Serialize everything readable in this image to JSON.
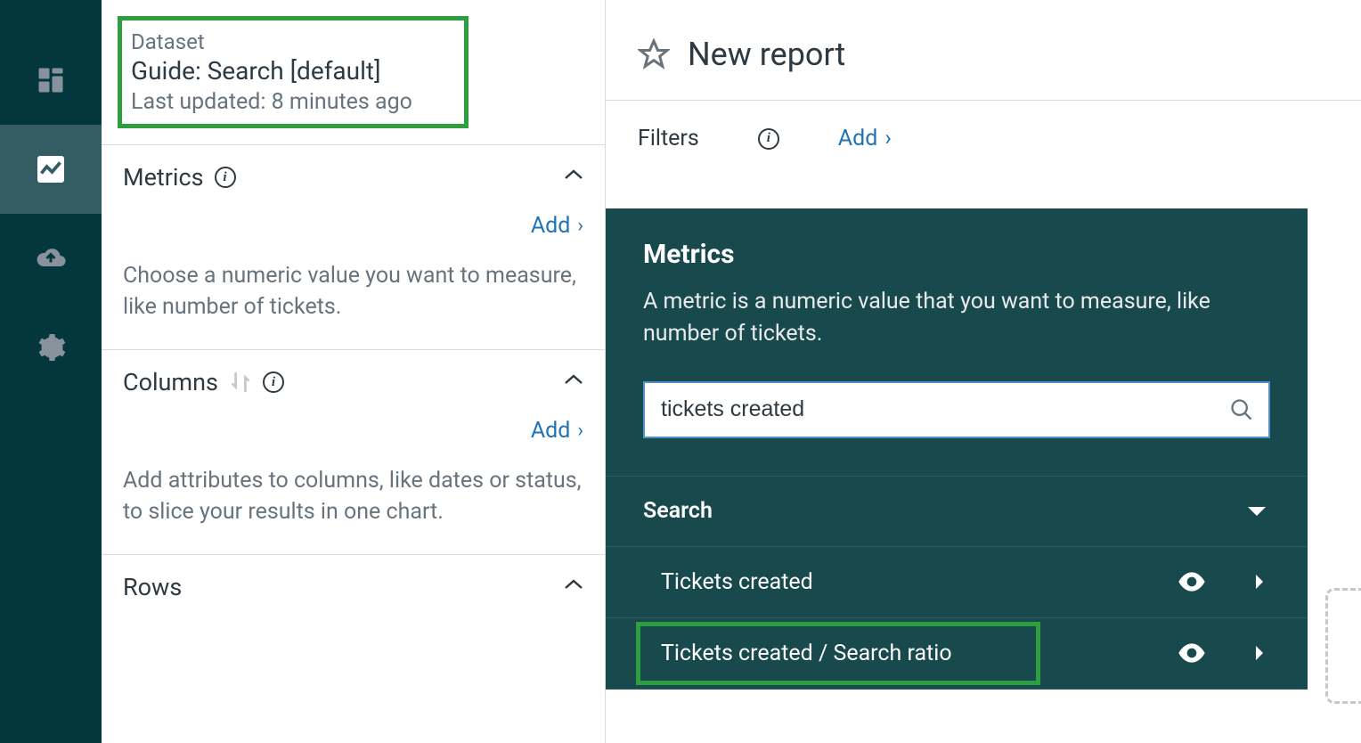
{
  "dataset": {
    "label": "Dataset",
    "name": "Guide: Search [default]",
    "updated": "Last updated: 8 minutes ago"
  },
  "sections": {
    "metrics": {
      "title": "Metrics",
      "add": "Add",
      "desc": "Choose a numeric value you want to measure, like number of tickets."
    },
    "columns": {
      "title": "Columns",
      "add": "Add",
      "desc": "Add attributes to columns, like dates or status, to slice your results in one chart."
    },
    "rows": {
      "title": "Rows"
    }
  },
  "report": {
    "title": "New report"
  },
  "filters": {
    "label": "Filters",
    "add": "Add"
  },
  "popover": {
    "title": "Metrics",
    "desc": "A metric is a numeric value that you want to measure, like number of tickets.",
    "search_value": "tickets created",
    "group": "Search",
    "items": [
      {
        "label": "Tickets created"
      },
      {
        "label": "Tickets created / Search ratio"
      }
    ]
  }
}
